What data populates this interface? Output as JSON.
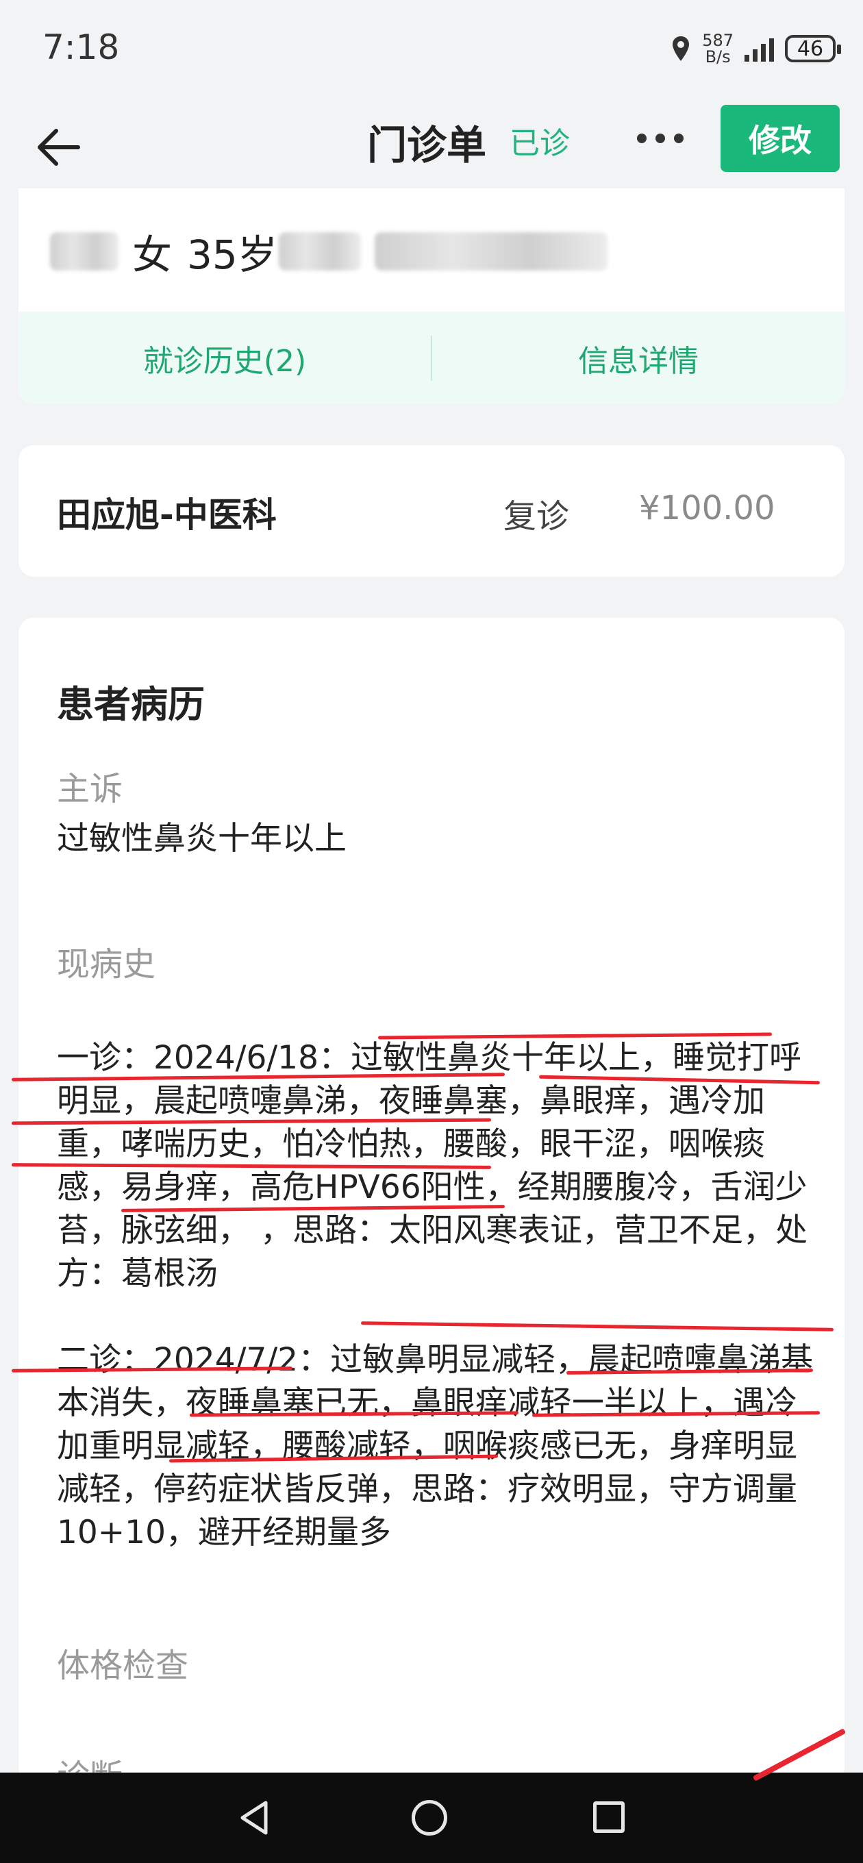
{
  "status_bar": {
    "time": "7:18",
    "net_speed_value": "587",
    "net_speed_unit": "B/s",
    "battery": "46",
    "icons": [
      "location-icon",
      "signal-icon",
      "battery-icon"
    ]
  },
  "header": {
    "title": "门诊单",
    "status": "已诊",
    "edit_label": "修改",
    "accent_color": "#1ab87a"
  },
  "patient": {
    "gender": "女",
    "age": "35岁"
  },
  "tabs": [
    {
      "label": "就诊历史(2)"
    },
    {
      "label": "信息详情"
    }
  ],
  "visit": {
    "doctor_dept": "田应旭-中医科",
    "visit_type": "复诊",
    "fee": "¥100.00"
  },
  "record": {
    "section_title": "患者病历",
    "chief_complaint_label": "主诉",
    "chief_complaint": "过敏性鼻炎十年以上",
    "history_label": "现病史",
    "history_visit1": "一诊：2024/6/18：过敏性鼻炎十年以上，睡觉打呼明显，晨起喷嚏鼻涕，夜睡鼻塞，鼻眼痒，遇冷加重，哮喘历史，怕冷怕热，腰酸，眼干涩，咽喉痰感，易身痒，高危HPV66阳性，经期腰腹冷，舌润少苔，脉弦细，    ，思路：太阳风寒表证，营卫不足，处方：葛根汤",
    "history_visit2": "二诊：2024/7/2：过敏鼻明显减轻，晨起喷嚏鼻涕基本消失，夜睡鼻塞已无，鼻眼痒减轻一半以上，遇冷加重明显减轻，腰酸减轻，咽喉痰感已无，身痒明显减轻，停药症状皆反弹，思路：疗效明显，守方调量10+10，避开经期量多",
    "exam_label": "体格检查",
    "diagnosis_label": "诊断"
  },
  "annotation_color": "#e8262f",
  "nav_icons": [
    "nav-back-icon",
    "nav-home-icon",
    "nav-recent-icon"
  ]
}
